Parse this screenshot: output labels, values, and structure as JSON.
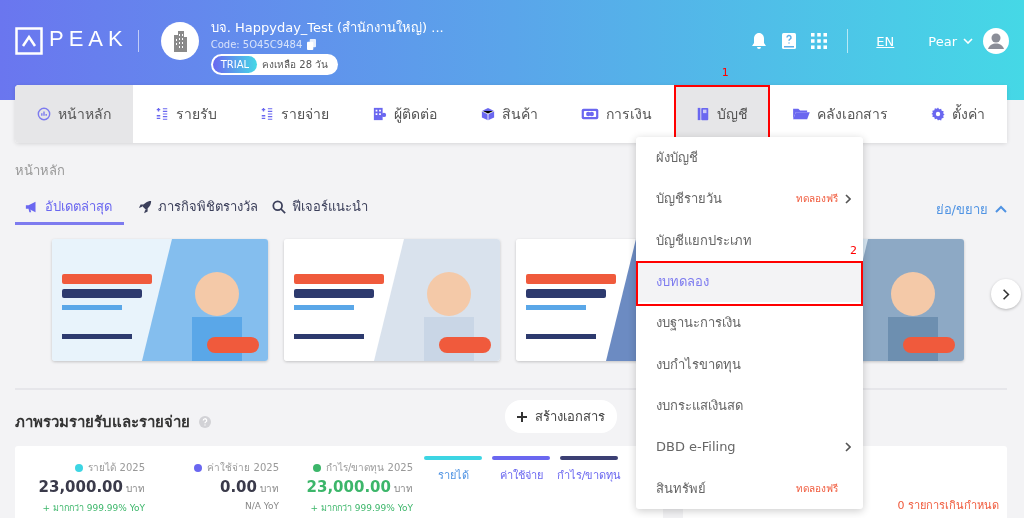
{
  "header": {
    "logo": "PEAK",
    "company": {
      "name": "บจ. Happyday_Test (สำนักงานใหญ่) ...",
      "code": "Code: 5O45C9484",
      "trial_badge": "TRIAL",
      "trial_remaining": "คงเหลือ 28 วัน"
    },
    "language": "EN",
    "user": "Pear"
  },
  "nav_tabs": [
    {
      "label": "หน้าหลัก",
      "selected": true
    },
    {
      "label": "รายรับ",
      "selected": false
    },
    {
      "label": "รายจ่าย",
      "selected": false
    },
    {
      "label": "ผู้ติดต่อ",
      "selected": false
    },
    {
      "label": "สินค้า",
      "selected": false
    },
    {
      "label": "การเงิน",
      "selected": false
    },
    {
      "label": "บัญชี",
      "selected": true,
      "annotation": "1"
    },
    {
      "label": "คลังเอกสาร",
      "selected": false
    },
    {
      "label": "ตั้งค่า",
      "selected": false
    }
  ],
  "breadcrumb": "หน้าหลัก",
  "sub_tabs": [
    {
      "label": "อัปเดตล่าสุด",
      "selected": true
    },
    {
      "label": "ภารกิจพิชิตรางวัล",
      "selected": false
    },
    {
      "label": "ฟีเจอร์แนะนำ",
      "selected": false
    }
  ],
  "collapse_link": "ย่อ/ขยาย",
  "dropdown": [
    {
      "label": "ผังบัญชี",
      "selected": false
    },
    {
      "label": "บัญชีรายวัน",
      "badge": "ทดลองฟรี",
      "submenu": true,
      "selected": false
    },
    {
      "label": "บัญชีแยกประเภท",
      "selected": false
    },
    {
      "label": "งบทดลอง",
      "selected": true,
      "annotation": "2"
    },
    {
      "label": "งบฐานะการเงิน",
      "selected": false
    },
    {
      "label": "งบกำไรขาดทุน",
      "selected": false
    },
    {
      "label": "งบกระแสเงินสด",
      "selected": false
    },
    {
      "label": "DBD e-Filing",
      "submenu": true,
      "selected": false
    },
    {
      "label": "สินทรัพย์",
      "badge": "ทดลองฟรี",
      "selected": false
    }
  ],
  "overview": {
    "title": "ภาพรวมรายรับและรายจ่าย",
    "create_button": "สร้างเอกสาร",
    "stats": [
      {
        "label": "รายได้ 2025",
        "color": "#3dd5e3",
        "amount": "23,000.00",
        "unit": "บาท",
        "yoy": "+ มากกว่า 999.99% YoY",
        "positive": true
      },
      {
        "label": "ค่าใช้จ่าย 2025",
        "color": "#6a67f0",
        "amount": "0.00",
        "unit": "บาท",
        "yoy": "N/A YoY",
        "positive": false
      },
      {
        "label": "กำไร/ขาดทุน 2025",
        "color": "#3cb66a",
        "amount": "23,000.00",
        "unit": "บาท",
        "yoy": "+ มากกว่า 999.99% YoY",
        "positive": true
      }
    ],
    "legend": [
      {
        "label": "รายได้",
        "color": "#3dd5e3"
      },
      {
        "label": "ค่าใช้จ่าย",
        "color": "#6a67f0"
      },
      {
        "label": "กำไร/ขาดทุน",
        "color": "#3b3f73"
      }
    ],
    "overdue": "0 รายการเกินกำหนด"
  }
}
